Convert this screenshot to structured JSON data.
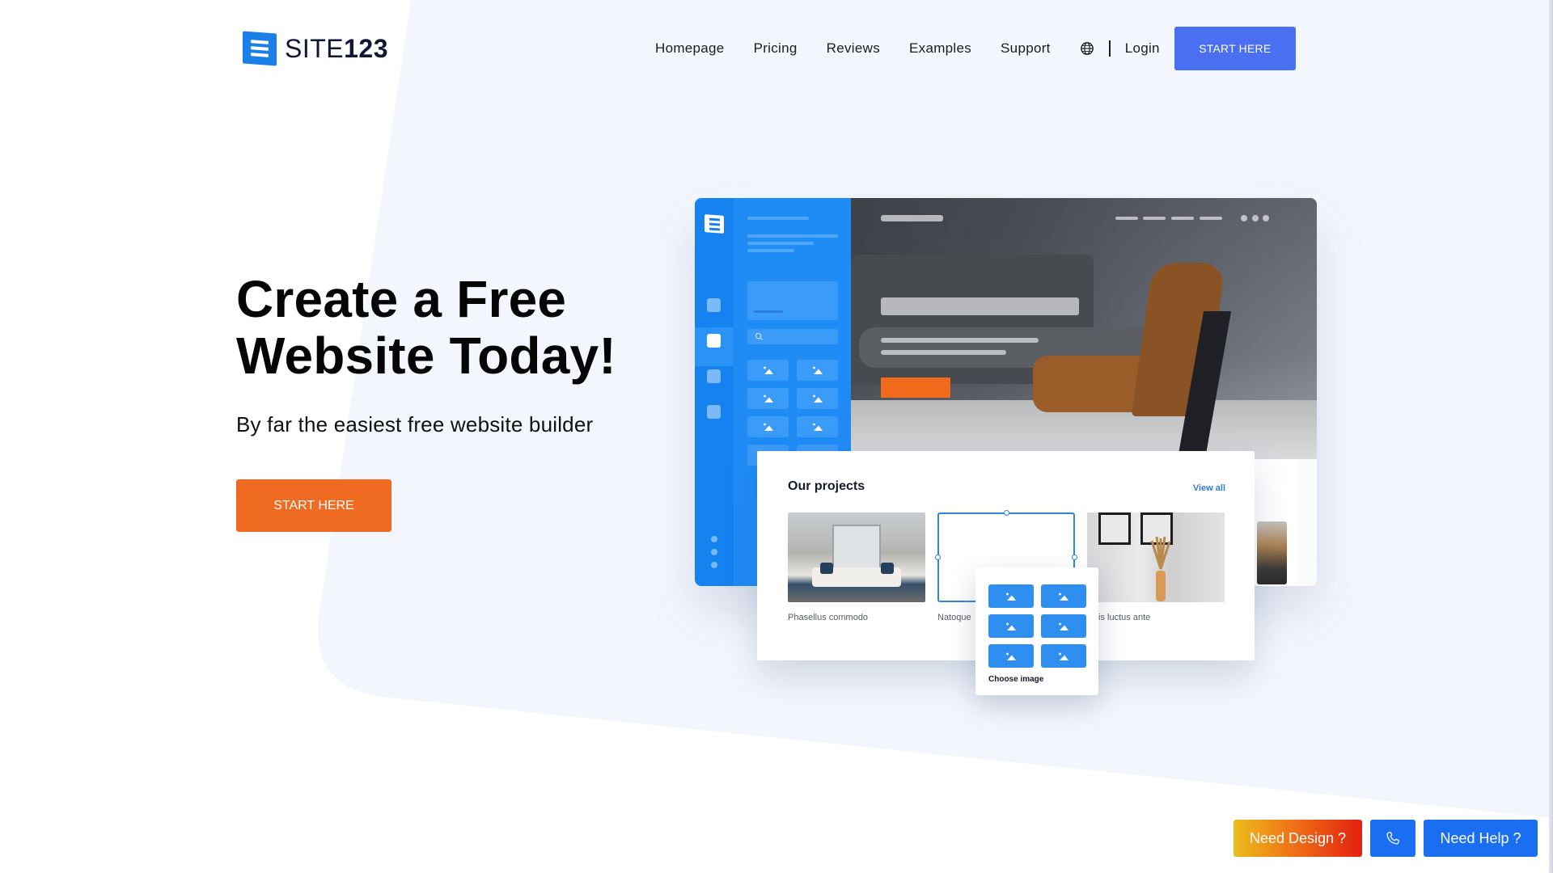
{
  "brand": {
    "name_text": "SITE",
    "name_number": "123",
    "logo_icon": "site123-logo-icon",
    "colors": {
      "primary_blue": "#1a7fe8",
      "nav_button": "#4a6ff0",
      "cta_orange": "#ef6b22",
      "help_blue": "#1a6ef2"
    }
  },
  "nav": {
    "items": [
      {
        "label": "Homepage"
      },
      {
        "label": "Pricing"
      },
      {
        "label": "Reviews"
      },
      {
        "label": "Examples"
      },
      {
        "label": "Support"
      }
    ],
    "language_icon": "globe-icon",
    "login_label": "Login",
    "start_label": "START HERE"
  },
  "hero": {
    "title_line1": "Create a Free",
    "title_line2": "Website Today!",
    "subtitle": "By far the easiest free website builder",
    "cta_label": "START HERE"
  },
  "mockup": {
    "projects_card": {
      "title": "Our projects",
      "view_all": "View all",
      "items": [
        {
          "label": "Phasellus commodo"
        },
        {
          "label": "Natoque"
        },
        {
          "label": "culis luctus ante"
        }
      ]
    },
    "image_chooser": {
      "label": "Choose image",
      "tile_count": 6
    }
  },
  "floating": {
    "design_label": "Need Design ?",
    "phone_icon": "phone-icon",
    "help_label": "Need Help ?"
  }
}
